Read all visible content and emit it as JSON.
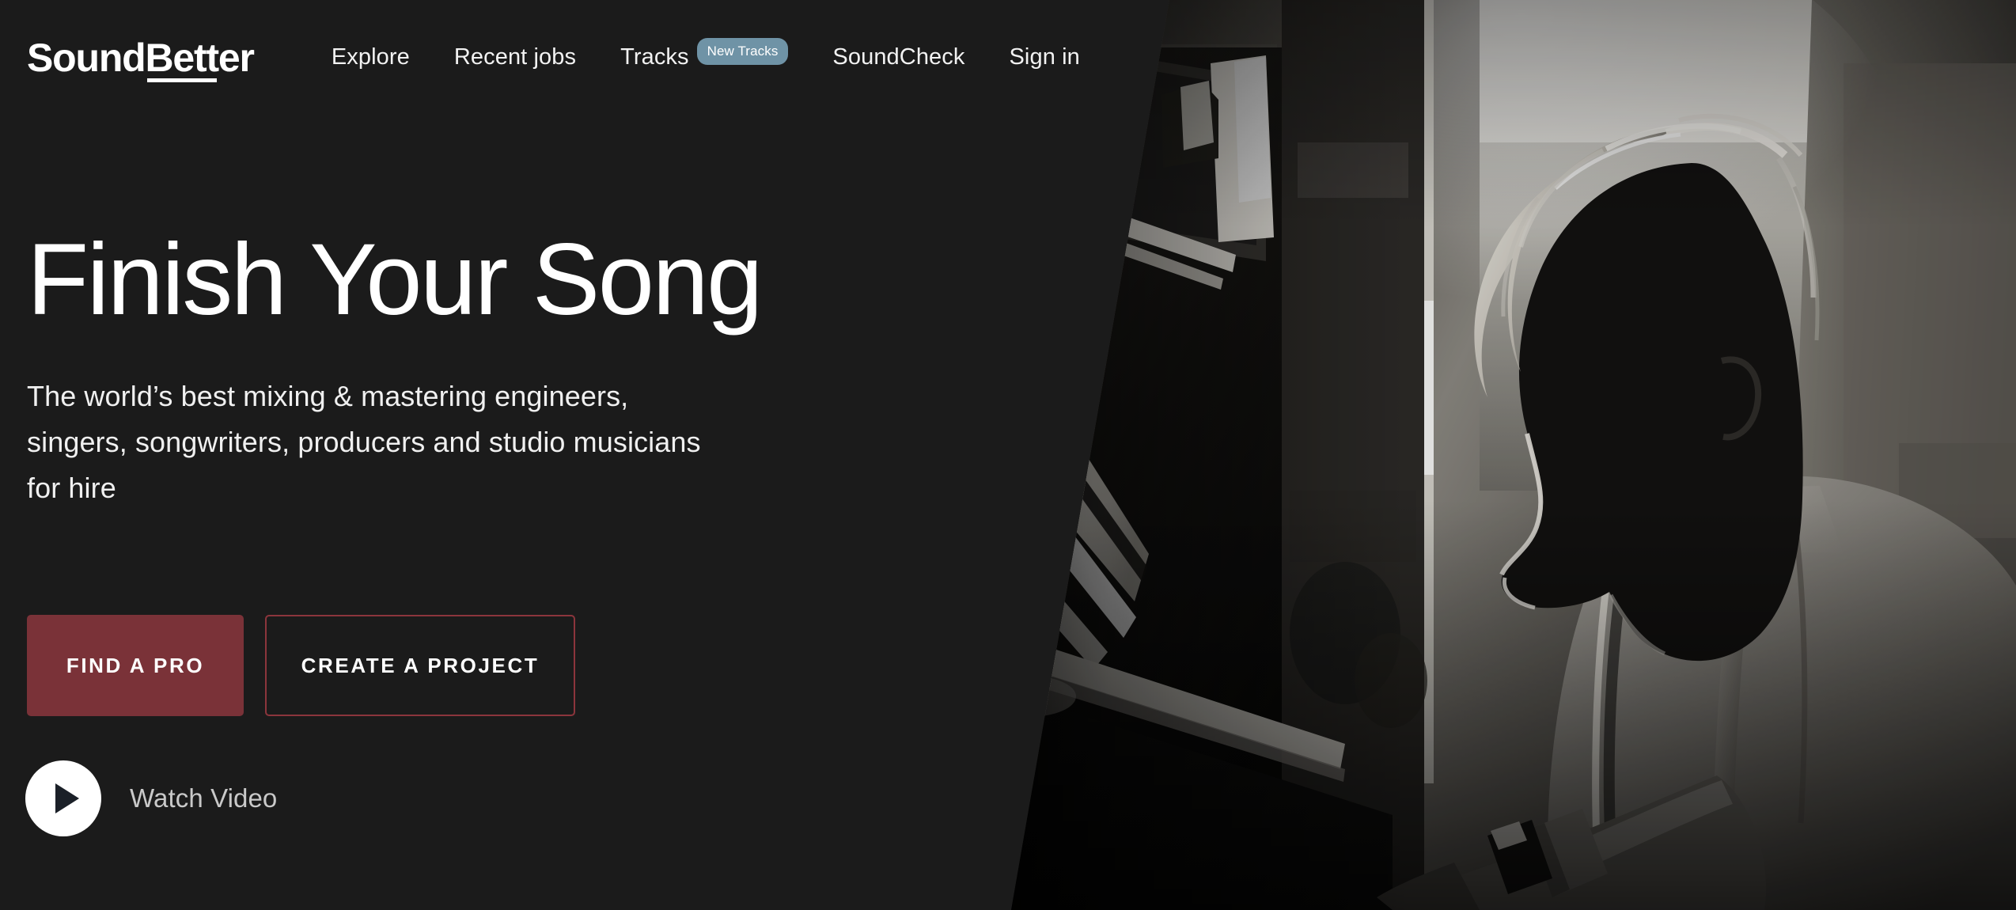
{
  "site": {
    "background_color": "#1b1b1b",
    "brand": {
      "text": "SoundBetter",
      "accent_underline": true
    }
  },
  "header": {
    "nav": [
      {
        "label": "Explore",
        "name": "nav-explore"
      },
      {
        "label": "Recent jobs",
        "name": "nav-recent-jobs"
      },
      {
        "label": "Tracks",
        "name": "nav-tracks",
        "badge": "New Tracks"
      },
      {
        "label": "SoundCheck",
        "name": "nav-soundcheck"
      },
      {
        "label": "Sign in",
        "name": "nav-sign-in"
      }
    ],
    "badge_color": "#6f93a6"
  },
  "hero": {
    "title": "Finish Your Song",
    "subtitle": "The world’s best mixing & mastering engineers, singers, songwriters, producers and studio musicians for hire",
    "buttons": {
      "primary": {
        "label": "FIND A PRO",
        "color": "#7a3238"
      },
      "secondary": {
        "label": "CREATE A PROJECT",
        "border_color": "#8c353c"
      }
    },
    "watch_video": {
      "label": "Watch Video",
      "icon": "play-icon"
    },
    "image_alt": "Black and white photo of a pianist in profile playing an upright piano, backlit"
  }
}
